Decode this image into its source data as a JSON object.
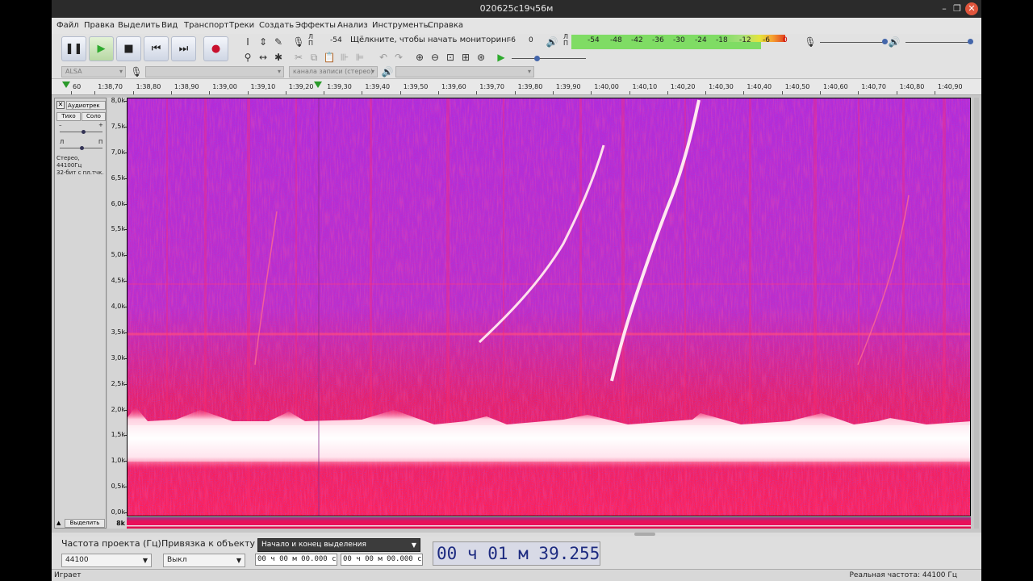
{
  "window": {
    "title": "020625c19ч56м",
    "minimize": "–",
    "maximize": "❐",
    "close": "✕"
  },
  "menu": [
    "Файл",
    "Правка",
    "Выделить",
    "Вид",
    "Транспорт",
    "Треки",
    "Создать",
    "Эффекты",
    "Анализ",
    "Инструменты",
    "Справка"
  ],
  "transport": {
    "pause": "❚❚",
    "play": "▶",
    "stop": "■",
    "skip_start": "⏮",
    "skip_end": "⏭",
    "record": "●"
  },
  "meters": {
    "record_lr": [
      "Л",
      "П"
    ],
    "record_left_value": "-54",
    "monitor_prompt": "Щёлкните, чтобы начать мониторинг",
    "record_right_ticks": [
      "-6",
      "0"
    ],
    "playback_lr": [
      "Л",
      "П"
    ],
    "playback_ticks": [
      "-54",
      "-48",
      "-42",
      "-36",
      "-30",
      "-24",
      "-18",
      "-12",
      "-6",
      "0"
    ]
  },
  "device_toolbar": {
    "host": "ALSA",
    "channels": "канала записи (стерео)"
  },
  "ruler_ticks": [
    "60",
    "1:38,70",
    "1:38,80",
    "1:38,90",
    "1:39,00",
    "1:39,10",
    "1:39,20",
    "1:39,30",
    "1:39,40",
    "1:39,50",
    "1:39,60",
    "1:39,70",
    "1:39,80",
    "1:39,90",
    "1:40,00",
    "1:40,10",
    "1:40,20",
    "1:40,30",
    "1:40,40",
    "1:40,50",
    "1:40,60",
    "1:40,70",
    "1:40,80",
    "1:40,90"
  ],
  "track": {
    "name": "Аудиотрек",
    "mute": "Тихо",
    "solo": "Соло",
    "gain_minus": "–",
    "gain_plus": "+",
    "pan_left": "Л",
    "pan_right": "П",
    "info_line1": "Стерео, 44100Гц",
    "info_line2": "32-бит с пл.тчк.",
    "select": "Выделить",
    "gain_level": 0.55,
    "pan_level": 0.5
  },
  "freq_scale": [
    "8,0k",
    "7,5k",
    "7,0k",
    "6,5k",
    "6,0k",
    "5,5k",
    "5,0k",
    "4,5k",
    "4,0k",
    "3,5k",
    "3,0k",
    "2,5k",
    "2,0k",
    "1,5k",
    "1,0k",
    "0,5k",
    "0,0k"
  ],
  "second_channel_label": "8k",
  "bottom": {
    "project_rate_label": "Частота проекта (Гц)",
    "project_rate": "44100",
    "snap_label": "Привязка к объекту",
    "snap_value": "Выкл",
    "selection_mode": "Начало и конец выделения",
    "sel_start": "00 ч 00 м 00.000 с",
    "sel_end": "00 ч 00 м 00.000 с",
    "position": "00 ч 01 м 39.255 с"
  },
  "status": {
    "left": "Играет",
    "right": "Реальная частота: 44100 Гц"
  },
  "colors": {
    "spectrum_bg": "#b82ad8",
    "spectrum_hot": "#ff2060",
    "spectrum_peak": "#ffffff",
    "accent_blue": "#1c2a80"
  }
}
